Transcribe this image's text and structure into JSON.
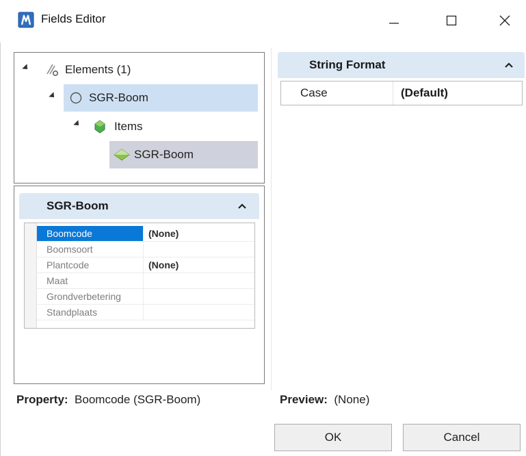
{
  "window": {
    "title": "Fields Editor",
    "icon": "app-logo-icon",
    "controls": [
      "minimize-icon",
      "maximize-icon",
      "close-icon"
    ]
  },
  "tree": {
    "root": {
      "label": "Elements (1)",
      "icon": "elements-link-icon"
    },
    "element": {
      "label": "SGR-Boom",
      "icon": "circle-outline-icon"
    },
    "items": {
      "label": "Items",
      "icon": "green-gem-icon"
    },
    "item": {
      "label": "SGR-Boom",
      "icon": "green-diamond-icon"
    }
  },
  "properties": {
    "section_title": "SGR-Boom",
    "rows": [
      {
        "key": "Boomcode",
        "value": "(None)",
        "selected": true
      },
      {
        "key": "Boomsoort",
        "value": ""
      },
      {
        "key": "Plantcode",
        "value": "(None)"
      },
      {
        "key": "Maat",
        "value": ""
      },
      {
        "key": "Grondverbetering",
        "value": ""
      },
      {
        "key": "Standplaats",
        "value": ""
      }
    ]
  },
  "format": {
    "section_title": "String Format",
    "rows": [
      {
        "key": "Case",
        "value": "(Default)"
      }
    ]
  },
  "status": {
    "property_label": "Property:",
    "property_value": "Boomcode (SGR-Boom)",
    "preview_label": "Preview:",
    "preview_value": "(None)"
  },
  "buttons": {
    "ok": "OK",
    "cancel": "Cancel"
  },
  "colors": {
    "section_header": "#dce9f5",
    "tree_selection": "#cde0f3",
    "item_selection": "#cfd1dc",
    "grid_selection": "#0a78d7"
  }
}
